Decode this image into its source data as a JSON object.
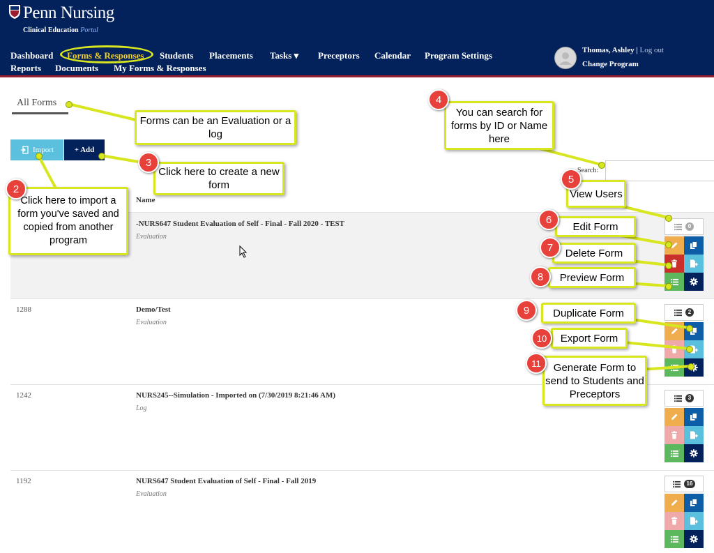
{
  "header": {
    "logo": "Penn Nursing",
    "subtitle": "Clinical Education",
    "subtitle_em": "Portal",
    "nav_row1": [
      "Dashboard",
      "Forms & Responses",
      "Students",
      "Placements",
      "Tasks ▾",
      "Preceptors",
      "Calendar",
      "Program Settings"
    ],
    "nav_row2": [
      "Reports",
      "Documents",
      "My Forms & Responses"
    ],
    "user_name": "Thomas, Ashley |",
    "logout": "Log out",
    "change_program": "Change Program"
  },
  "page": {
    "title": "All Forms",
    "import_label": "Import",
    "add_label": "+ Add",
    "search_label": "Search:",
    "name_header": "Name"
  },
  "rows": [
    {
      "id": "",
      "name": "-NURS647 Student Evaluation of Self - Final - Fall 2020 - TEST",
      "type": "Evaluation",
      "users": "0"
    },
    {
      "id": "1288",
      "name": "Demo/Test",
      "type": "Evaluation",
      "users": "2"
    },
    {
      "id": "1242",
      "name": "NURS245--Simulation - Imported on (7/30/2019 8:21:46 AM)",
      "type": "Log",
      "users": "3"
    },
    {
      "id": "1192",
      "name": "NURS647 Student Evaluation of Self - Final - Fall 2019",
      "type": "Evaluation",
      "users": "16"
    }
  ],
  "annotations": {
    "forms_note": "Forms can be an Evaluation or a log",
    "c2": "Click here to import a form you've saved and copied from another program",
    "c3": "Click here to create a new form",
    "c4": "You can search for forms by ID or Name here",
    "c5": "View Users",
    "c6": "Edit Form",
    "c7": "Delete Form",
    "c8": "Preview Form",
    "c9": "Duplicate Form",
    "c10": "Export Form",
    "c11": "Generate Form to send to Students and Preceptors",
    "b2": "2",
    "b3": "3",
    "b4": "4",
    "b5": "5",
    "b6": "6",
    "b7": "7",
    "b8": "8",
    "b9": "9",
    "b10": "10",
    "b11": "11"
  },
  "colors": {
    "header": "#03225c",
    "accent_red": "#9b1e2e",
    "nav_active": "#f5d023",
    "import": "#5bc0de",
    "add": "#03225c",
    "edit": "#f0ad4e",
    "delete": "#c9302c",
    "preview": "#5cb85c",
    "duplicate": "#0d5ea6",
    "export": "#5bc0de",
    "settings": "#03225c",
    "highlight": "#d7e61f",
    "badge": "#e8403a"
  }
}
